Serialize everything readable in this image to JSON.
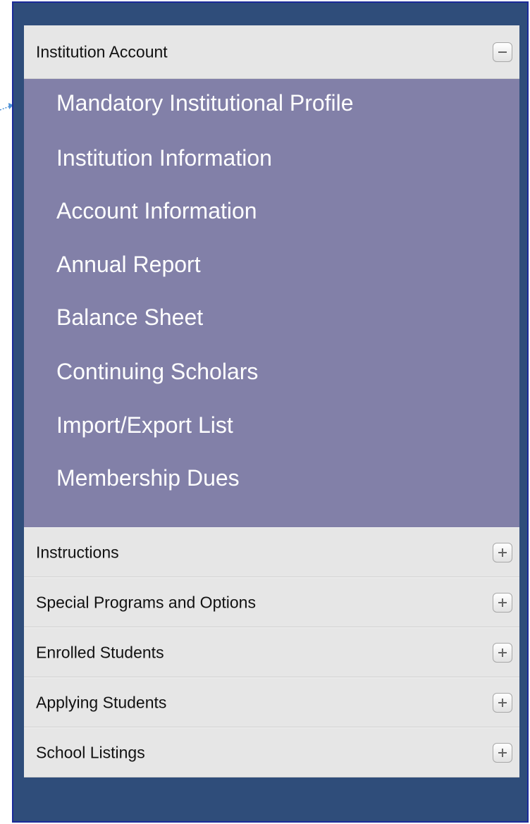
{
  "accordion": {
    "open_section": {
      "label": "Institution Account",
      "toggle_icon": "minus-icon",
      "items": [
        {
          "label": "Mandatory Institutional Profile"
        },
        {
          "label": "Institution Information"
        },
        {
          "label": "Account Information"
        },
        {
          "label": "Annual Report"
        },
        {
          "label": "Balance Sheet"
        },
        {
          "label": "Continuing Scholars"
        },
        {
          "label": "Import/Export List"
        },
        {
          "label": "Membership Dues"
        }
      ]
    },
    "collapsed_sections": [
      {
        "label": "Instructions",
        "toggle_icon": "plus-icon"
      },
      {
        "label": "Special Programs and Options",
        "toggle_icon": "plus-icon"
      },
      {
        "label": "Enrolled Students",
        "toggle_icon": "plus-icon"
      },
      {
        "label": "Applying Students",
        "toggle_icon": "plus-icon"
      },
      {
        "label": "School Listings",
        "toggle_icon": "plus-icon"
      }
    ]
  },
  "colors": {
    "frame_background": "#2f4d7a",
    "open_panel_background": "#8280a8",
    "header_background": "#e6e6e6",
    "pointer_arrow": "#4a8fd6"
  }
}
